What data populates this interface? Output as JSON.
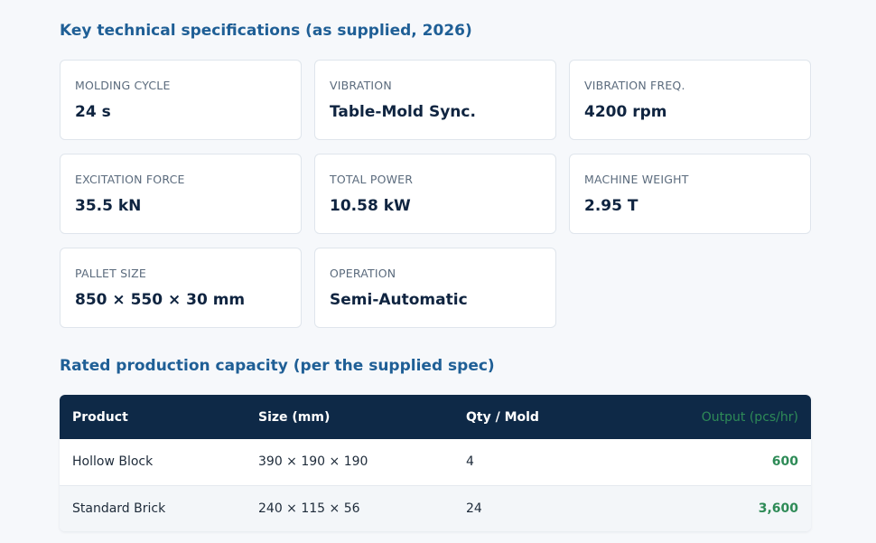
{
  "specs_section": {
    "title": "Key technical specifications (as supplied, 2026)",
    "cards": [
      {
        "label": "MOLDING CYCLE",
        "value": "24 s"
      },
      {
        "label": "VIBRATION",
        "value": "Table-Mold Sync."
      },
      {
        "label": "VIBRATION FREQ.",
        "value": "4200 rpm"
      },
      {
        "label": "EXCITATION FORCE",
        "value": "35.5 kN"
      },
      {
        "label": "TOTAL POWER",
        "value": "10.58 kW"
      },
      {
        "label": "MACHINE WEIGHT",
        "value": "2.95 T"
      },
      {
        "label": "PALLET SIZE",
        "value": "850 × 550 × 30 mm"
      },
      {
        "label": "OPERATION",
        "value": "Semi-Automatic"
      }
    ]
  },
  "capacity_section": {
    "title": "Rated production capacity (per the supplied spec)",
    "headers": [
      "Product",
      "Size (mm)",
      "Qty / Mold",
      "Output (pcs/hr)"
    ],
    "rows": [
      [
        "Hollow Block",
        "390 × 190 × 190",
        "4",
        "600"
      ],
      [
        "Standard Brick",
        "240 × 115 × 56",
        "24",
        "3,600"
      ]
    ]
  }
}
